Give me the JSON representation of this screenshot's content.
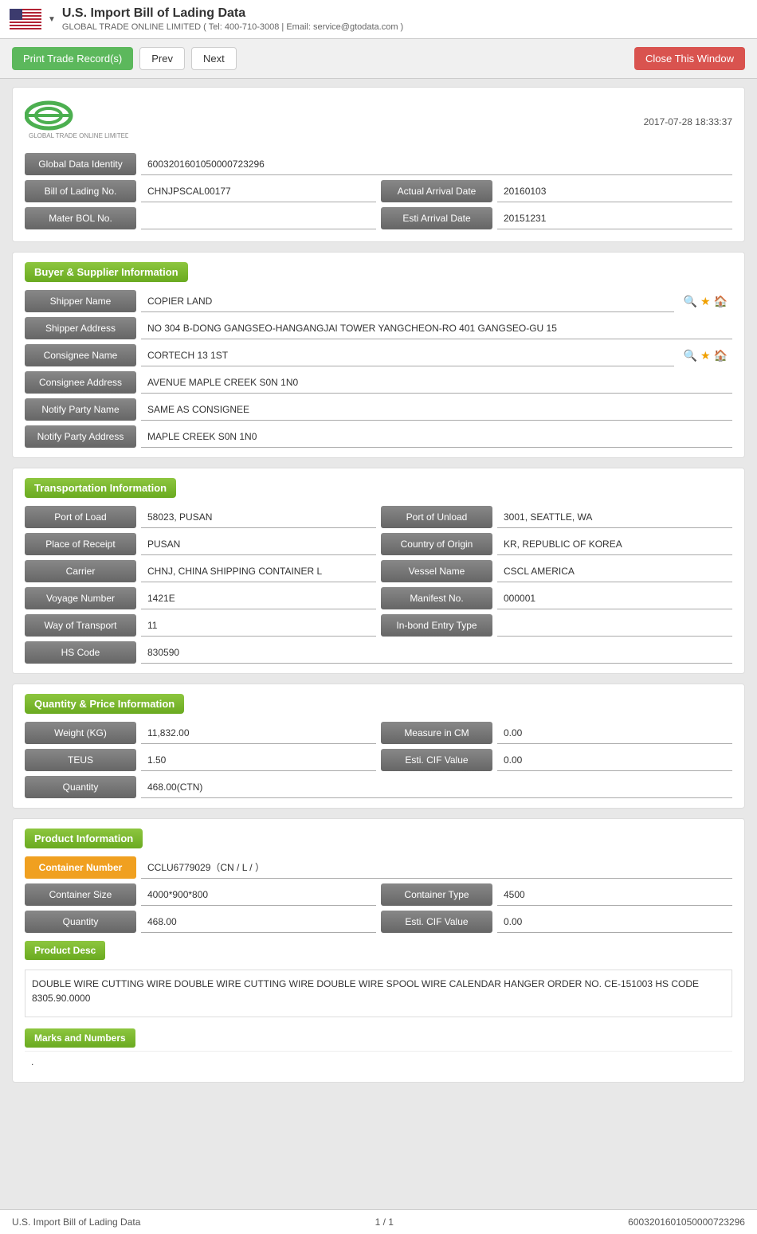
{
  "topBar": {
    "title": "U.S. Import Bill of Lading Data",
    "subtitle": "GLOBAL TRADE ONLINE LIMITED ( Tel: 400-710-3008 | Email: service@gtodata.com )",
    "dropdownArrow": "▼"
  },
  "toolbar": {
    "printLabel": "Print Trade Record(s)",
    "prevLabel": "Prev",
    "nextLabel": "Next",
    "closeLabel": "Close This Window"
  },
  "logo": {
    "company": "GLOBAL TRADE ONLINE LIMITED",
    "timestamp": "2017-07-28 18:33:37"
  },
  "identity": {
    "globalDataIdentityLabel": "Global Data Identity",
    "globalDataIdentityValue": "6003201601050000723296",
    "billOfLadingLabel": "Bill of Lading No.",
    "billOfLadingValue": "CHNJPSCAL00177",
    "actualArrivalLabel": "Actual Arrival Date",
    "actualArrivalValue": "20160103",
    "masterBolLabel": "Mater BOL No.",
    "masterBolValue": "",
    "estiArrivalLabel": "Esti Arrival Date",
    "estiArrivalValue": "20151231"
  },
  "buyerSupplier": {
    "sectionTitle": "Buyer & Supplier Information",
    "shipperNameLabel": "Shipper Name",
    "shipperNameValue": "COPIER LAND",
    "shipperAddressLabel": "Shipper Address",
    "shipperAddressValue": "NO 304 B-DONG GANGSEO-HANGANGJAI TOWER YANGCHEON-RO 401 GANGSEO-GU 15",
    "consigneeNameLabel": "Consignee Name",
    "consigneeNameValue": "CORTECH 13 1ST",
    "consigneeAddressLabel": "Consignee Address",
    "consigneeAddressValue": "AVENUE MAPLE CREEK S0N 1N0",
    "notifyPartyNameLabel": "Notify Party Name",
    "notifyPartyNameValue": "SAME AS CONSIGNEE",
    "notifyPartyAddressLabel": "Notify Party Address",
    "notifyPartyAddressValue": "MAPLE CREEK S0N 1N0"
  },
  "transportation": {
    "sectionTitle": "Transportation Information",
    "portOfLoadLabel": "Port of Load",
    "portOfLoadValue": "58023, PUSAN",
    "portOfUnloadLabel": "Port of Unload",
    "portOfUnloadValue": "3001, SEATTLE, WA",
    "placeOfReceiptLabel": "Place of Receipt",
    "placeOfReceiptValue": "PUSAN",
    "countryOfOriginLabel": "Country of Origin",
    "countryOfOriginValue": "KR, REPUBLIC OF KOREA",
    "carrierLabel": "Carrier",
    "carrierValue": "CHNJ, CHINA SHIPPING CONTAINER L",
    "vesselNameLabel": "Vessel Name",
    "vesselNameValue": "CSCL AMERICA",
    "voyageNumberLabel": "Voyage Number",
    "voyageNumberValue": "1421E",
    "manifestNoLabel": "Manifest No.",
    "manifestNoValue": "000001",
    "wayOfTransportLabel": "Way of Transport",
    "wayOfTransportValue": "11",
    "inBondEntryLabel": "In-bond Entry Type",
    "inBondEntryValue": "",
    "hsCodeLabel": "HS Code",
    "hsCodeValue": "830590"
  },
  "quantityPrice": {
    "sectionTitle": "Quantity & Price Information",
    "weightLabel": "Weight (KG)",
    "weightValue": "11,832.00",
    "measureLabel": "Measure in CM",
    "measureValue": "0.00",
    "teusLabel": "TEUS",
    "teusValue": "1.50",
    "estiCifLabel": "Esti. CIF Value",
    "estiCifValue": "0.00",
    "quantityLabel": "Quantity",
    "quantityValue": "468.00(CTN)"
  },
  "product": {
    "sectionTitle": "Product Information",
    "containerNumberLabel": "Container Number",
    "containerNumberValue": "CCLU6779029（CN / L / ）",
    "containerSizeLabel": "Container Size",
    "containerSizeValue": "4000*900*800",
    "containerTypeLabel": "Container Type",
    "containerTypeValue": "4500",
    "quantityLabel": "Quantity",
    "quantityValue": "468.00",
    "estiCifLabel": "Esti. CIF Value",
    "estiCifValue": "0.00",
    "productDescLabel": "Product Desc",
    "productDescValue": "DOUBLE WIRE CUTTING WIRE DOUBLE WIRE CUTTING WIRE DOUBLE WIRE SPOOL WIRE CALENDAR HANGER ORDER NO. CE-151003 HS CODE 8305.90.0000",
    "marksAndNumbersLabel": "Marks and Numbers",
    "marksAndNumbersValue": "."
  },
  "footer": {
    "leftText": "U.S. Import Bill of Lading Data",
    "centerText": "1 / 1",
    "rightText": "6003201601050000723296"
  }
}
